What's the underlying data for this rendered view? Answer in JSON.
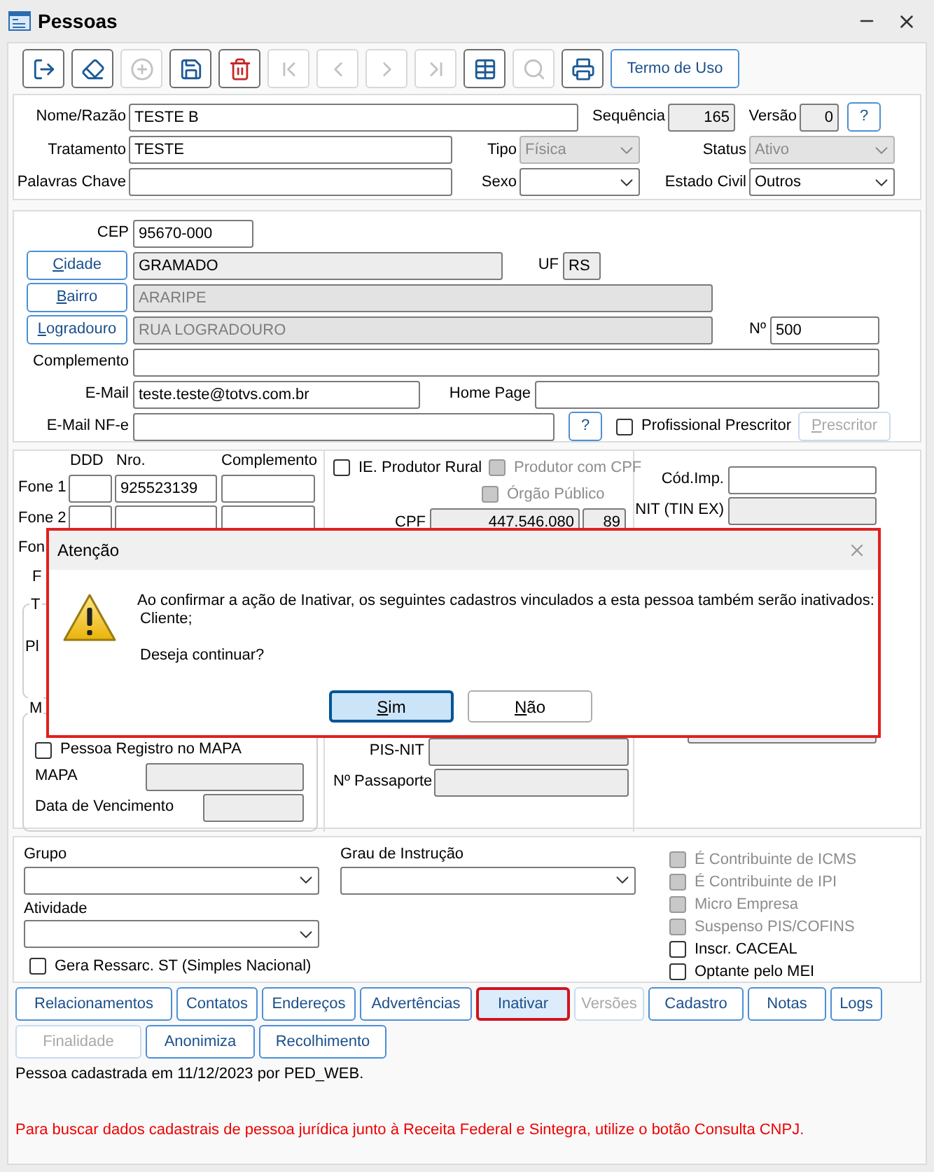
{
  "window": {
    "title": "Pessoas"
  },
  "toolbar": [
    {
      "kind": "exit",
      "disabled": false
    },
    {
      "kind": "clear",
      "disabled": false
    },
    {
      "kind": "add",
      "disabled": true
    },
    {
      "kind": "save",
      "disabled": false
    },
    {
      "kind": "delete",
      "disabled": false
    },
    {
      "kind": "first",
      "disabled": true
    },
    {
      "kind": "previous",
      "disabled": true
    },
    {
      "kind": "next",
      "disabled": true
    },
    {
      "kind": "last",
      "disabled": true
    },
    {
      "kind": "grid",
      "disabled": false
    },
    {
      "kind": "search",
      "disabled": true
    },
    {
      "kind": "print",
      "disabled": false
    }
  ],
  "terms_button": "Termo de Uso",
  "identity": {
    "name": {
      "label": "Nome/Razão",
      "value": "TESTE B"
    },
    "sequence": {
      "label": "Sequência",
      "value": "165"
    },
    "version": {
      "label": "Versão",
      "value": "0"
    },
    "help": "?",
    "treatment": {
      "label": "Tratamento",
      "value": "TESTE"
    },
    "type": {
      "label": "Tipo",
      "value": "Física",
      "disabled": true
    },
    "status": {
      "label": "Status",
      "value": "Ativo",
      "disabled": true
    },
    "keywords": {
      "label": "Palavras Chave"
    },
    "sex": {
      "label": "Sexo"
    },
    "marital_status": {
      "label": "Estado Civil",
      "value": "Outros",
      "disabled": false
    }
  },
  "address": {
    "cep": {
      "label": "CEP",
      "value": "95670-000"
    },
    "city": {
      "label": "Cidade",
      "value": "GRAMADO",
      "underline_first": true
    },
    "uf": {
      "label": "UF",
      "value": "RS"
    },
    "district": {
      "label": "Bairro",
      "value": "ARARIPE",
      "disabled": true,
      "underline_first": true
    },
    "street": {
      "label": "Logradouro",
      "value": "RUA LOGRADOURO",
      "disabled": true,
      "underline_first": true
    },
    "number": {
      "label": "Nº",
      "value": "500"
    },
    "complement": {
      "label": "Complemento"
    },
    "email": {
      "label": "E-Mail",
      "value": "teste.teste@totvs.com.br"
    },
    "home_page": {
      "label": "Home Page"
    },
    "email_nfe": {
      "label": "E-Mail NF-e"
    },
    "help": "?",
    "prescriber": {
      "label": "Profissional Prescritor",
      "checked": false
    },
    "prescriber_button": {
      "label": "Prescritor",
      "disabled": true,
      "underline_first": true
    }
  },
  "phones": {
    "headers": [
      "DDD",
      "Nro.",
      "Complemento"
    ],
    "rows": [
      {
        "label": "Fone 1",
        "number": "925523139"
      },
      {
        "label": "Fone 2"
      }
    ],
    "cut_label": "Fon",
    "cut_label_2": "F"
  },
  "group_1": {
    "title": "T",
    "label": "Pl"
  },
  "group_2": {
    "title": "M",
    "registry": {
      "label": "Pessoa Registro no MAPA",
      "checked": false
    },
    "mapa_label": "MAPA",
    "expiry_label": "Data de Vencimento"
  },
  "fiscal": {
    "rural": {
      "label": "IE. Produtor Rural",
      "checked": false,
      "disabled": false
    },
    "cpf_producer": {
      "label": "Produtor com CPF",
      "checked": false,
      "disabled": true
    },
    "public_agency": {
      "label": "Órgão Público",
      "checked": false,
      "disabled": true
    },
    "cpf": {
      "label": "CPF",
      "value": "447.546.080",
      "digits": "89"
    },
    "pis": {
      "label": "PIS-NIT"
    },
    "passport": {
      "label": "Nº Passaporte"
    }
  },
  "tax_ids": {
    "cod_imp": {
      "label": "Cód.Imp."
    },
    "nit": {
      "label": "NIT (TIN EX)"
    }
  },
  "classification": {
    "group": {
      "label": "Grupo"
    },
    "education": {
      "label": "Grau de Instrução"
    },
    "activity": {
      "label": "Atividade"
    },
    "st": {
      "label": "Gera Ressarc. ST (Simples Nacional)",
      "checked": false,
      "disabled": false
    },
    "flags": [
      {
        "label": "É Contribuinte de ICMS",
        "checked": false,
        "disabled": true
      },
      {
        "label": "É Contribuinte de IPI",
        "checked": false,
        "disabled": true
      },
      {
        "label": "Micro Empresa",
        "checked": false,
        "disabled": true
      },
      {
        "label": "Suspenso PIS/COFINS",
        "checked": false,
        "disabled": true
      },
      {
        "label": "Inscr. CACEAL",
        "checked": false,
        "disabled": false
      },
      {
        "label": "Optante pelo MEI",
        "checked": false,
        "disabled": false
      }
    ]
  },
  "action_rows": [
    {
      "buttons": [
        {
          "label": "Relacionamentos",
          "disabled": false,
          "selected": false
        },
        {
          "label": "Contatos",
          "disabled": false,
          "selected": false
        },
        {
          "label": "Endereços",
          "disabled": false,
          "selected": false
        },
        {
          "label": "Advertências",
          "disabled": false,
          "selected": false
        },
        {
          "label": "Inativar",
          "disabled": false,
          "selected": true
        },
        {
          "label": "Versões",
          "disabled": true,
          "selected": false
        },
        {
          "label": "Cadastro",
          "disabled": false,
          "selected": false
        },
        {
          "label": "Notas",
          "disabled": false,
          "selected": false
        },
        {
          "label": "Logs",
          "disabled": false,
          "selected": false
        }
      ]
    },
    {
      "buttons": [
        {
          "label": "Finalidade",
          "disabled": true,
          "selected": false
        },
        {
          "label": "Anonimiza",
          "disabled": false,
          "selected": false
        },
        {
          "label": "Recolhimento",
          "disabled": false,
          "selected": false
        }
      ]
    }
  ],
  "created_note": "Pessoa cadastrada em 11/12/2023 por PED_WEB.",
  "hint": "Para buscar dados cadastrais de pessoa jurídica junto à Receita Federal e Sintegra, utilize o botão Consulta CNPJ.",
  "dialog": {
    "title": "Atenção",
    "message": "Ao confirmar a ação de Inativar, os seguintes cadastros vinculados a esta pessoa também serão inativados:",
    "items": [
      "Cliente;"
    ],
    "question": "Deseja continuar?",
    "buttons": [
      {
        "label": "Sim",
        "selected": true,
        "underline_first": true
      },
      {
        "label": "Não",
        "selected": false,
        "underline_first": true
      }
    ]
  }
}
